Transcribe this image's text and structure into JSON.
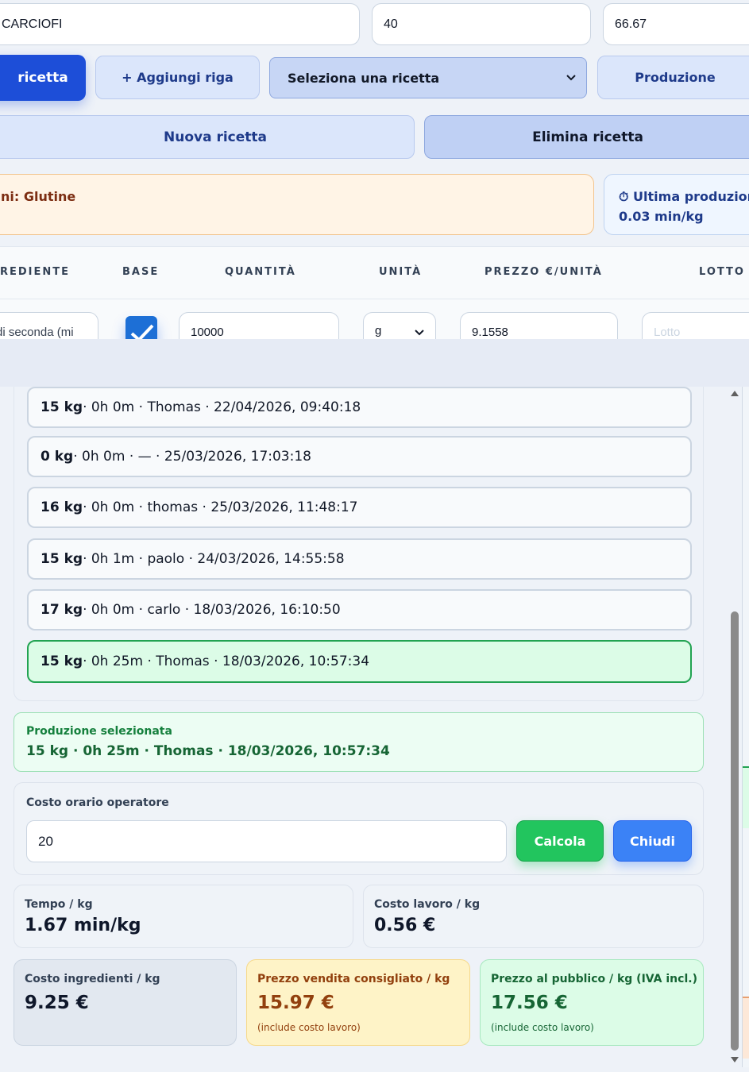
{
  "form": {
    "name_value": "CARCIOFI",
    "qty_value": "40",
    "price_value": "66.67"
  },
  "toolbar": {
    "save_recipe": "ricetta",
    "add_row": "+ Aggiungi riga",
    "recipe_select": "Seleziona una ricetta",
    "production": "Produzione",
    "new_recipe": "Nuova ricetta",
    "delete_recipe": "Elimina ricetta"
  },
  "allergens_text": "ni: Glutine",
  "last_production": {
    "title": "⏱ Ultima produzion",
    "value": "0.03 min/kg"
  },
  "table": {
    "headers": [
      "REDIENTE",
      "BASE",
      "QUANTITÀ",
      "UNITÀ",
      "PREZZO €/UNITÀ",
      "LOTTO"
    ],
    "row": {
      "ingredient": "di seconda (mi",
      "quantity": "10000",
      "unit": "g",
      "price": "9.1558",
      "lot_placeholder": "Lotto"
    }
  },
  "productions": [
    {
      "kg": "15 kg",
      "rest": " · 0h 0m · Thomas · 22/04/2026, 09:40:18",
      "selected": false
    },
    {
      "kg": "0 kg",
      "rest": " · 0h 0m · — · 25/03/2026, 17:03:18",
      "selected": false
    },
    {
      "kg": "16 kg",
      "rest": " · 0h 0m · thomas · 25/03/2026, 11:48:17",
      "selected": false
    },
    {
      "kg": "15 kg",
      "rest": " · 0h 1m · paolo · 24/03/2026, 14:55:58",
      "selected": false
    },
    {
      "kg": "17 kg",
      "rest": " · 0h 0m · carlo · 18/03/2026, 16:10:50",
      "selected": false
    },
    {
      "kg": "15 kg",
      "rest": " · 0h 25m · Thomas · 18/03/2026, 10:57:34",
      "selected": true
    }
  ],
  "selected_production": {
    "label": "Produzione selezionata",
    "value": "15 kg · 0h 25m · Thomas · 18/03/2026, 10:57:34"
  },
  "operator_cost": {
    "label": "Costo orario operatore",
    "value": "20",
    "calc_button": "Calcola",
    "close_button": "Chiudi"
  },
  "results": {
    "time_per_kg": {
      "label": "Tempo / kg",
      "value": "1.67 min/kg"
    },
    "labor_cost_per_kg": {
      "label": "Costo lavoro / kg",
      "value": "0.56 €"
    },
    "ingredient_cost_per_kg": {
      "label": "Costo ingredienti / kg",
      "value": "9.25 €"
    },
    "suggested_price": {
      "label": "Prezzo vendita consigliato / kg",
      "value": "15.97 €",
      "note": "(include costo lavoro)"
    },
    "public_price": {
      "label": "Prezzo al pubblico / kg (IVA incl.)",
      "value": "17.56 €",
      "note": "(include costo lavoro)"
    }
  },
  "colors": {
    "primary": "#1d4ed8",
    "accent_green": "#22c55e",
    "accent_blue": "#3b82f6",
    "selected_green": "#dcfce7",
    "warning_bg": "#fef3c7",
    "allergen_bg": "#fff4e6"
  }
}
